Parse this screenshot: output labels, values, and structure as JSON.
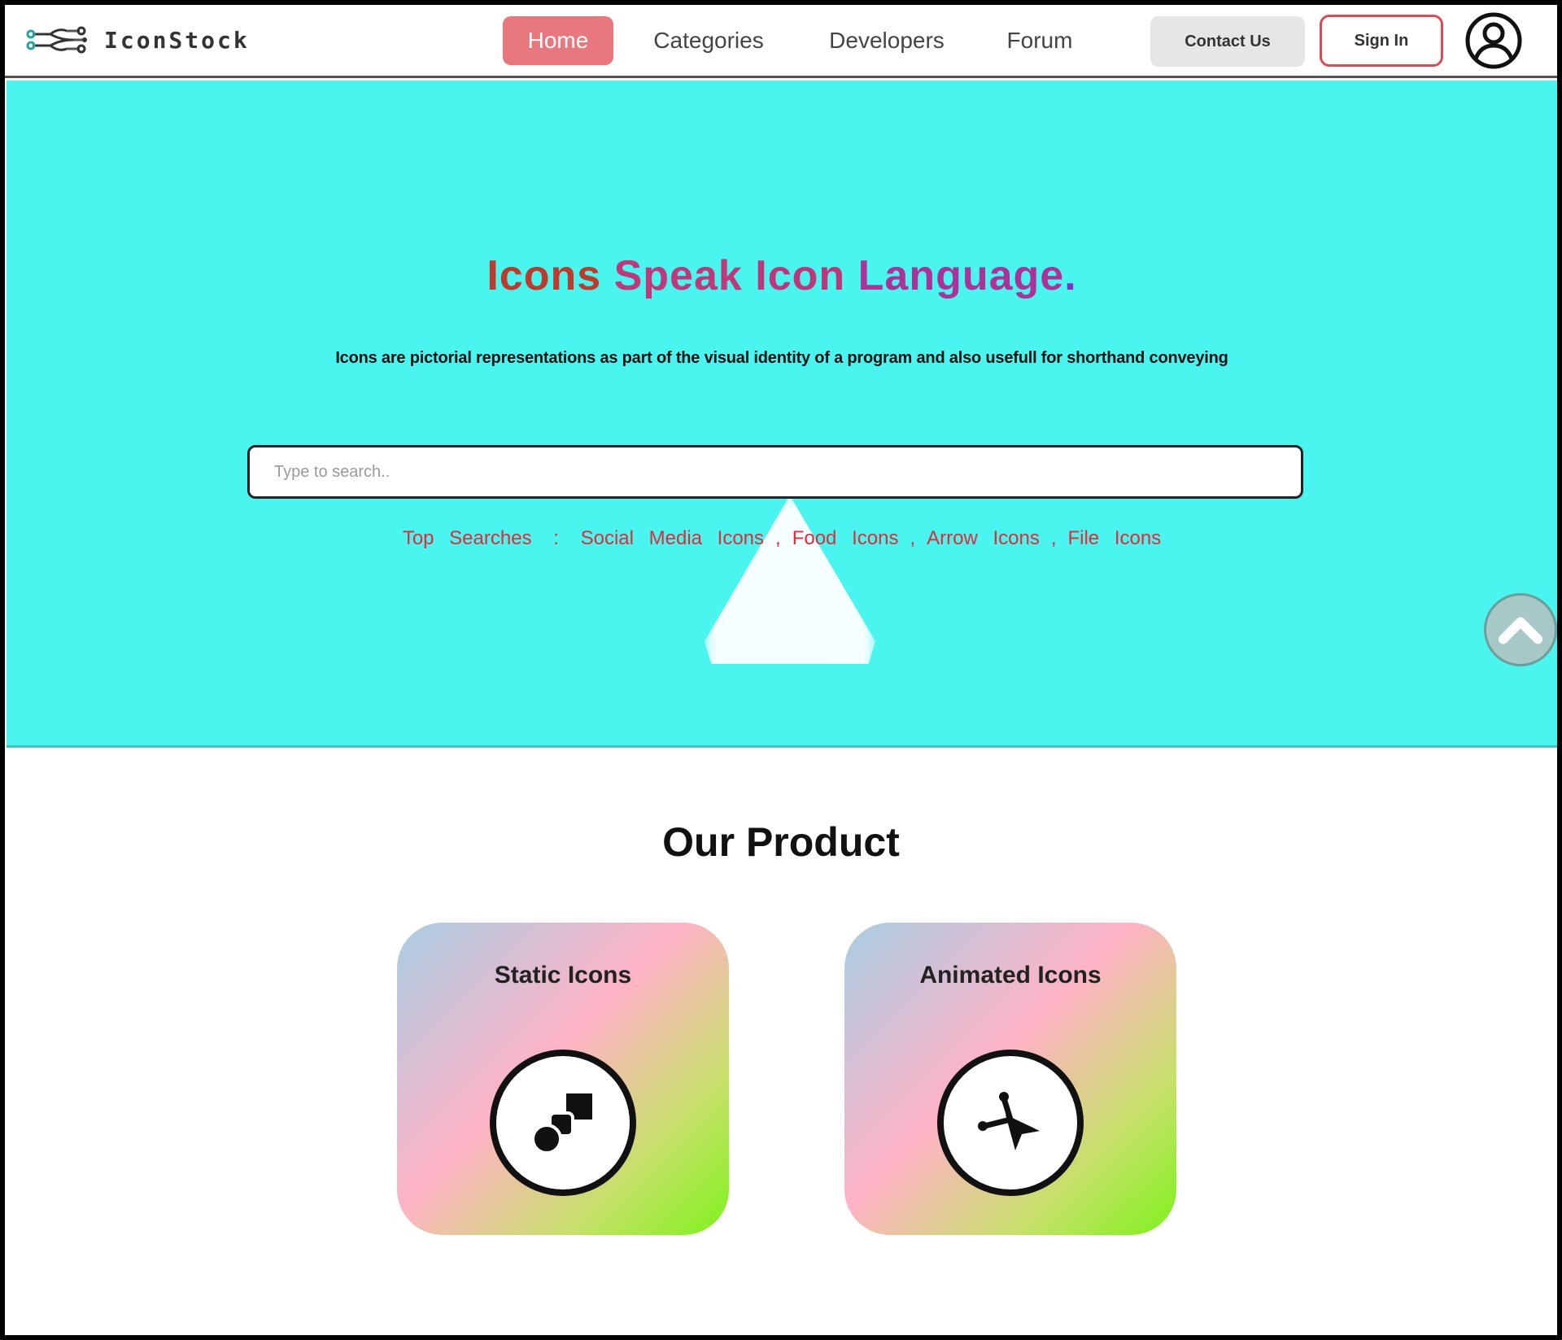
{
  "brand": {
    "name": "IconStock",
    "logo_icon": "network-nodes-icon"
  },
  "nav": {
    "home": "Home",
    "categories": "Categories",
    "developers": "Developers",
    "forum": "Forum",
    "contact": "Contact Us",
    "signin": "Sign In",
    "profile_icon": "user-circle-icon"
  },
  "hero": {
    "title_words": [
      "Icons",
      "Speak",
      "Icon",
      "Language",
      "."
    ],
    "subtitle": "Icons are pictorial representations as part of the visual identity of a program and also usefull for shorthand conveying",
    "search_placeholder": "Type to search..",
    "top_searches_label": "Top Searches",
    "top_searches_colon": ":",
    "top_searches": [
      "Social Media Icons",
      "Food Icons",
      "Arrow Icons",
      "File Icons"
    ],
    "scroll_icon": "chevron-up-icon"
  },
  "products": {
    "title": "Our Product",
    "cards": [
      {
        "title": "Static Icons",
        "icon": "shapes-icon"
      },
      {
        "title": "Animated Icons",
        "icon": "animated-cursor-icon"
      }
    ]
  },
  "colors": {
    "hero_bg": "#4bf5ef",
    "home_active": "#e8787e",
    "signin_border": "#d84c56",
    "top_search_text": "#e02b3a"
  }
}
